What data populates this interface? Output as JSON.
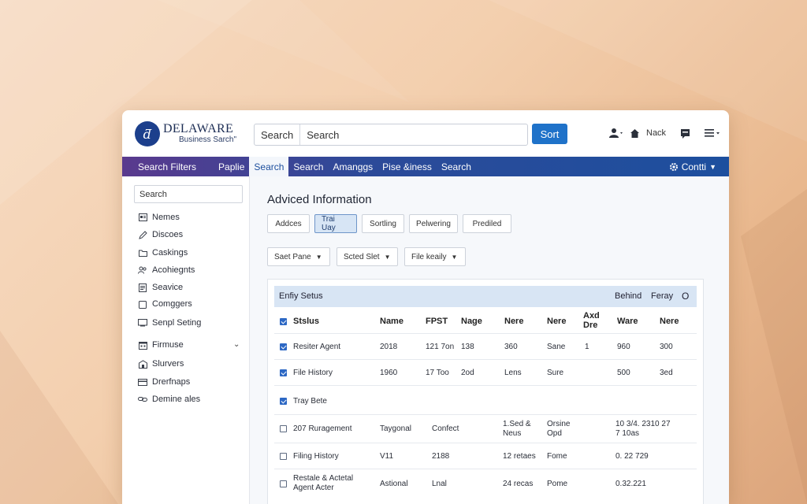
{
  "header": {
    "logo_title": "DELAWARE",
    "logo_subtitle": "Business Sarch\"",
    "search_label": "Search",
    "search_value": "Search",
    "sort_label": "Sort",
    "user_text": "Nack"
  },
  "navbar": {
    "items": [
      "Search Filters",
      "Paplie",
      "Search",
      "Search",
      "Amanggs",
      "Pise &iness",
      "Search"
    ],
    "active_index": 2,
    "right_label": "Contti"
  },
  "sidebar": {
    "search_placeholder": "Search",
    "items": [
      {
        "label": "Nemes",
        "icon": "id-card-icon"
      },
      {
        "label": "Discoes",
        "icon": "pencil-icon"
      },
      {
        "label": "Caskings",
        "icon": "folder-icon"
      },
      {
        "label": "Acohiegnts",
        "icon": "people-icon"
      },
      {
        "label": "Seavice",
        "icon": "document-icon"
      },
      {
        "label": "Comggers",
        "icon": "clipboard-icon"
      },
      {
        "label": "Senpl Seting",
        "icon": "monitor-icon"
      },
      {
        "label": "Firmuse",
        "icon": "calendar-icon"
      },
      {
        "label": "Slurvers",
        "icon": "building-icon"
      },
      {
        "label": "Drerfnaps",
        "icon": "card-icon"
      },
      {
        "label": "Demine ales",
        "icon": "link-icon"
      }
    ]
  },
  "main": {
    "title": "Adviced Information",
    "tabs": [
      "Addces",
      "Trai Uay",
      "Sortling",
      "Pelwering",
      "Prediled"
    ],
    "active_tab": 1,
    "filters": [
      "Saet Pane",
      "Scted Slet",
      "File keaily"
    ]
  },
  "table": {
    "panel_title": "Enfiy Setus",
    "panel_right_1": "Behind",
    "panel_right_2": "Feray",
    "panel_right_3": "O",
    "columns": [
      "Stslus",
      "Name",
      "FPST",
      "Nage",
      "Nere",
      "Nere",
      "Axd Dre",
      "Ware",
      "Nere"
    ],
    "rows": [
      {
        "checked": true,
        "cells": [
          "Resiter Agent",
          "2018",
          "121 7on",
          "138",
          "360",
          "Sane",
          "1",
          "960",
          "300"
        ]
      },
      {
        "checked": true,
        "cells": [
          "File History",
          "1960",
          "17 Too",
          "2od",
          "Lens",
          "Sure",
          "",
          "500",
          "3ed"
        ]
      },
      {
        "checked": true,
        "cells": [
          "Tray Bete",
          "",
          "",
          "",
          "",
          "",
          "",
          "",
          ""
        ]
      },
      {
        "checked": false,
        "cells": [
          "207 Ruragement",
          "Taygonal",
          "Confect",
          "",
          "1.Sed & Neus",
          "Orsine Opd",
          "",
          "10 3/4. 2310 27 7 10as",
          ""
        ]
      },
      {
        "checked": false,
        "cells": [
          "Filing History",
          "V11",
          "2188",
          "",
          "12 retaes",
          "Fome",
          "",
          "0. 22 729",
          ""
        ]
      },
      {
        "checked": false,
        "cells": [
          "Restale & Actetal Agent Acter",
          "Astional",
          "Lnal",
          "",
          "24 recas",
          "Pome",
          "",
          "0.32.221",
          ""
        ]
      }
    ]
  },
  "colors": {
    "accent_blue": "#1f72c9",
    "nav_start": "#5a3a8e",
    "nav_end": "#1d4f9e",
    "table_header": "#d8e5f4"
  }
}
